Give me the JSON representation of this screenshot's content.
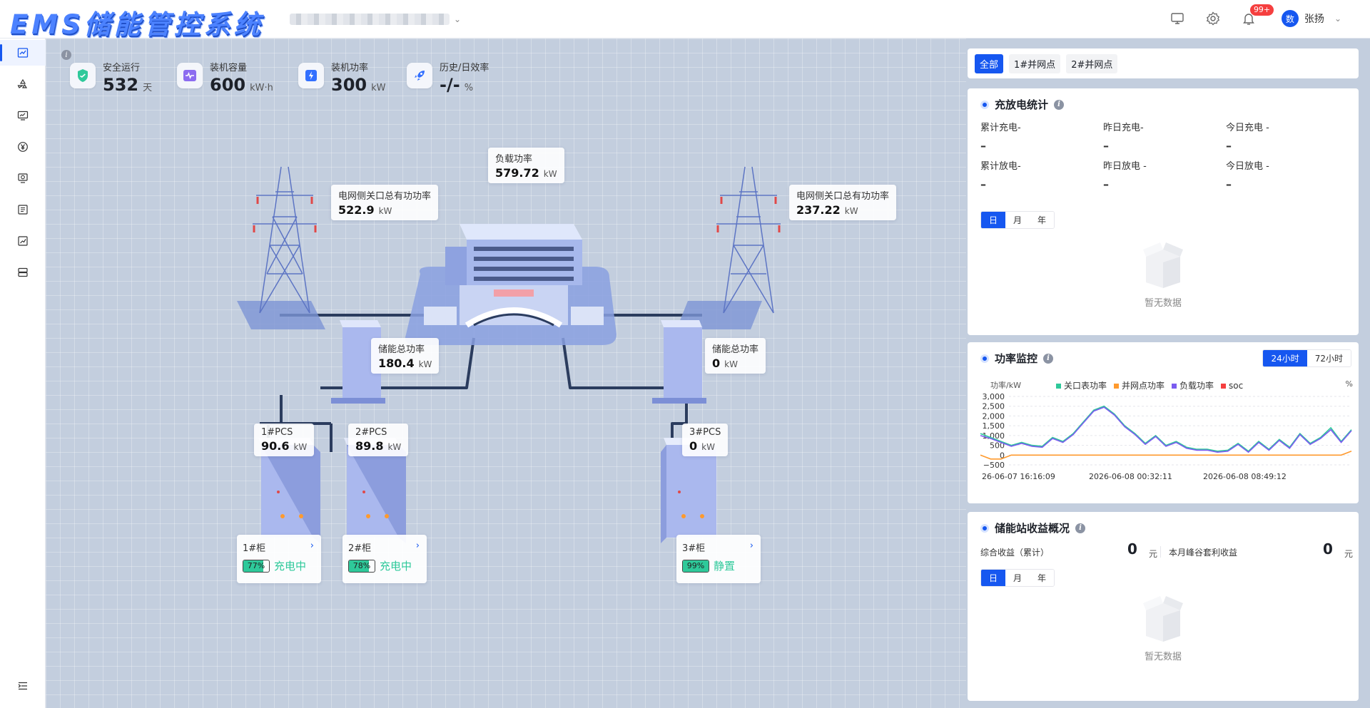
{
  "app": {
    "title": "EMS储能管控系统",
    "notification_count": "99+",
    "user_name": "张扬",
    "user_avatar": "数"
  },
  "sidebar": {
    "items": [
      "dashboard-chart-icon",
      "recycle-icon",
      "monitor-icon",
      "yuan-icon",
      "screen-swap-icon",
      "list-icon",
      "trend-icon",
      "server-icon"
    ],
    "collapse_icon": "menu-fold-icon"
  },
  "stats": [
    {
      "label": "安全运行",
      "value": "532",
      "unit": "天",
      "icon": "shield-check-icon",
      "color": "#2ec99a"
    },
    {
      "label": "装机容量",
      "value": "600",
      "unit": "kW·h",
      "icon": "wave-icon",
      "color": "#8c6cf0"
    },
    {
      "label": "装机功率",
      "value": "300",
      "unit": "kW",
      "icon": "bolt-icon",
      "color": "#3370ff"
    },
    {
      "label": "历史/日效率",
      "value": "-/-",
      "unit": "%",
      "icon": "rocket-icon",
      "color": "#3370ff"
    }
  ],
  "diagram": {
    "load": {
      "label": "负载功率",
      "value": "579.72",
      "unit": "kW"
    },
    "grid_left": {
      "label": "电网侧关口总有功功率",
      "value": "522.9",
      "unit": "kW"
    },
    "grid_right": {
      "label": "电网侧关口总有功功率",
      "value": "237.22",
      "unit": "kW"
    },
    "storage_left": {
      "label": "储能总功率",
      "value": "180.4",
      "unit": "kW"
    },
    "storage_right": {
      "label": "储能总功率",
      "value": "0",
      "unit": "kW"
    },
    "pcs": [
      {
        "label": "1#PCS",
        "value": "90.6",
        "unit": "kW"
      },
      {
        "label": "2#PCS",
        "value": "89.8",
        "unit": "kW"
      },
      {
        "label": "3#PCS",
        "value": "0",
        "unit": "kW"
      }
    ],
    "cabinets": [
      {
        "name": "1#柜",
        "soc": "77%",
        "soc_value": 77,
        "status": "充电中"
      },
      {
        "name": "2#柜",
        "soc": "78%",
        "soc_value": 78,
        "status": "充电中"
      },
      {
        "name": "3#柜",
        "soc": "99%",
        "soc_value": 99,
        "status": "静置"
      }
    ]
  },
  "right": {
    "tabs": [
      "全部",
      "1#并网点",
      "2#并网点"
    ],
    "charge": {
      "title": "充放电统计",
      "items": [
        {
          "label": "累计充电-",
          "value": "–"
        },
        {
          "label": "昨日充电-",
          "value": "–"
        },
        {
          "label": "今日充电 -",
          "value": "–"
        },
        {
          "label": "累计放电-",
          "value": "–"
        },
        {
          "label": "昨日放电 -",
          "value": "–"
        },
        {
          "label": "今日放电 -",
          "value": "–"
        }
      ],
      "periods": [
        "日",
        "月",
        "年"
      ],
      "empty_text": "暂无数据"
    },
    "power": {
      "title": "功率监控",
      "ranges": [
        "24小时",
        "72小时"
      ],
      "y_unit": "功率/kW",
      "right_unit": "%"
    },
    "income": {
      "title": "储能站收益概况",
      "total_label": "综合收益（累计）",
      "total_value": "0",
      "total_unit": "元",
      "month_label": "本月峰谷套利收益",
      "month_value": "0",
      "month_unit": "元",
      "periods": [
        "日",
        "月",
        "年"
      ],
      "empty_text": "暂无数据"
    }
  },
  "chart_data": {
    "type": "line",
    "ylabel": "功率/kW",
    "ylim": [
      -500,
      3000
    ],
    "yticks": [
      "3,000",
      "2,500",
      "2,000",
      "1,500",
      "1,000",
      "500",
      "0",
      "−500"
    ],
    "xtick_labels": [
      "26-06-07 16:16:09",
      "2026-06-08 00:32:11",
      "2026-06-08 08:49:12"
    ],
    "series": [
      {
        "name": "关口表功率",
        "color": "#2ec99a",
        "values": [
          1100,
          900,
          700,
          500,
          650,
          500,
          450,
          900,
          700,
          1100,
          1700,
          2300,
          2500,
          2100,
          1500,
          1100,
          600,
          1000,
          500,
          700,
          400,
          300,
          300,
          200,
          250,
          600,
          200,
          700,
          300,
          800,
          400,
          1100,
          600,
          900,
          1400,
          700,
          1300
        ]
      },
      {
        "name": "并网点功率",
        "color": "#ff9a2e",
        "values": [
          0,
          -200,
          -200,
          0,
          0,
          0,
          0,
          0,
          0,
          0,
          0,
          0,
          0,
          0,
          0,
          0,
          0,
          0,
          0,
          0,
          0,
          0,
          0,
          0,
          0,
          0,
          0,
          0,
          0,
          0,
          0,
          0,
          0,
          0,
          0,
          0,
          200
        ]
      },
      {
        "name": "负载功率",
        "color": "#7b5cf0",
        "values": [
          1000,
          850,
          650,
          450,
          600,
          450,
          400,
          850,
          650,
          1050,
          1650,
          2250,
          2450,
          2050,
          1450,
          1050,
          550,
          950,
          450,
          650,
          350,
          250,
          250,
          150,
          200,
          550,
          150,
          650,
          250,
          750,
          350,
          1050,
          550,
          850,
          1300,
          650,
          1250
        ]
      },
      {
        "name": "soc",
        "color": "#f53f3f",
        "values": []
      }
    ]
  }
}
